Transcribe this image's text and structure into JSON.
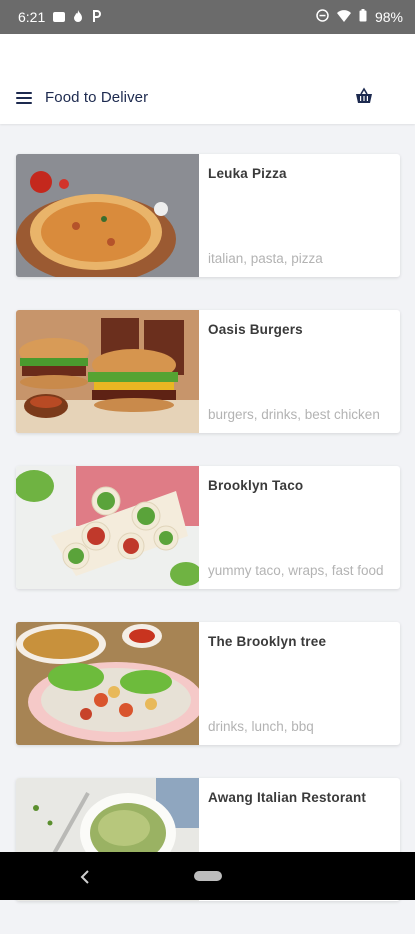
{
  "status_bar": {
    "time": "6:21",
    "battery": "98%",
    "icons": [
      "image-icon",
      "flame-icon",
      "p-badge-icon",
      "do-not-disturb-icon",
      "wifi-icon",
      "battery-icon"
    ]
  },
  "app_bar": {
    "title": "Food to Deliver",
    "menu_icon": "menu-icon",
    "basket_icon": "basket-icon",
    "accent": "#1d2a4f"
  },
  "restaurants": [
    {
      "name": "Leuka Pizza",
      "tags": "italian, pasta, pizza",
      "image": "pizza-photo"
    },
    {
      "name": "Oasis Burgers",
      "tags": "burgers, drinks, best chicken",
      "image": "burgers-photo"
    },
    {
      "name": "Brooklyn Taco",
      "tags": "yummy taco, wraps, fast food",
      "image": "wraps-photo"
    },
    {
      "name": "The Brooklyn tree",
      "tags": "drinks, lunch, bbq",
      "image": "bbq-photo"
    },
    {
      "name": "Awang Italian Restorant",
      "tags": "",
      "image": "pasta-photo"
    }
  ],
  "nav_bar": {
    "back_icon": "back-icon",
    "home_icon": "home-pill-icon"
  }
}
